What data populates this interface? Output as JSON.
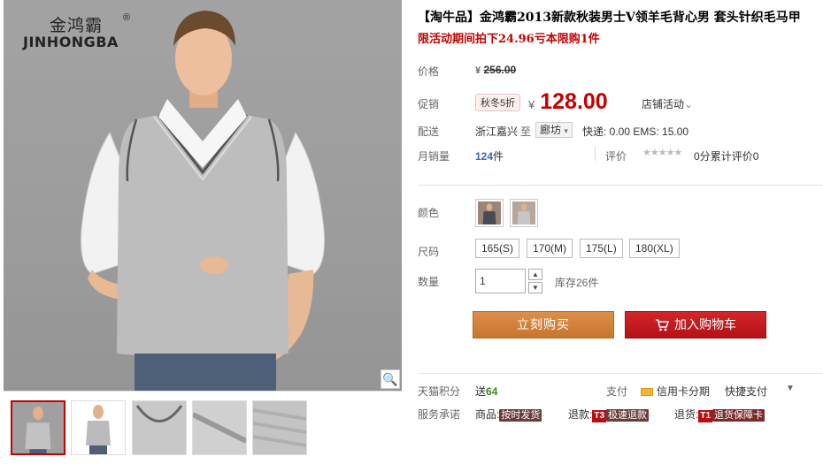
{
  "brand": {
    "cn": "金鸿霸",
    "reg": "®",
    "en": "JINHONGBA"
  },
  "product": {
    "title": "【淘牛品】金鸿霸2013新款秋装男士V领羊毛背心男 套头针织毛马甲",
    "promo_line": "限活动期间拍下24.96亏本限购1件"
  },
  "price": {
    "label": "价格",
    "currency": "¥",
    "original": "256.00"
  },
  "promo": {
    "label": "促销",
    "discount_tag": "秋冬5折",
    "currency": "¥",
    "price": "128.00",
    "store_activity": "店铺活动",
    "store_activity_caret": "⌄"
  },
  "shipping": {
    "label": "配送",
    "from": "浙江嘉兴",
    "to_word": "至",
    "city": "廊坊",
    "city_caret": "▾",
    "fee": "快递: 0.00 EMS: 15.00"
  },
  "sales": {
    "label": "月销量",
    "count": "124",
    "unit": "件",
    "review_label": "评价",
    "stars": "★★★★★",
    "score": "0分",
    "review_text": "累计评价",
    "review_count": "0"
  },
  "color": {
    "label": "颜色"
  },
  "size": {
    "label": "尺码",
    "options": [
      "165(S)",
      "170(M)",
      "175(L)",
      "180(XL)"
    ]
  },
  "quantity": {
    "label": "数量",
    "value": "1",
    "up": "▲",
    "down": "▼",
    "stock": "库存26件"
  },
  "actions": {
    "buy_now": "立刻购买",
    "add_cart": "加入购物车"
  },
  "points": {
    "label": "天猫积分",
    "prefix": "送",
    "value": "64"
  },
  "payment": {
    "label": "支付",
    "credit": "信用卡分期",
    "fast": "快捷支付",
    "more": "▼"
  },
  "service": {
    "label": "服务承诺",
    "goods_prefix": "商品:",
    "goods_tag": "按时发货",
    "refund_prefix": "退款:",
    "refund_code": "T3",
    "refund_tag": "极速退款",
    "return_prefix": "退货:",
    "return_code": "T1",
    "return_tag": "退货保障卡"
  },
  "gallery": {
    "zoom_icon": "🔍"
  },
  "colors": {
    "accent_red": "#c40000",
    "buy_orange": "#d4833c",
    "cart_red": "#c41a1e"
  }
}
